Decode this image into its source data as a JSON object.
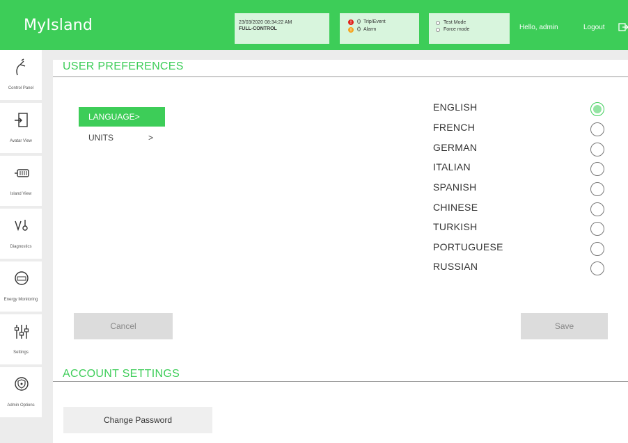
{
  "header": {
    "brand": "MyIsland",
    "datetime": "23/03/2020 08:34:22 AM",
    "control_mode": "FULL-CONTROL",
    "trips_count": "0",
    "trips_label": "Trip/Event",
    "alarms_count": "0",
    "alarms_label": "Alarm",
    "test_mode": "Test Mode",
    "force_mode": "Force mode",
    "greeting": "Hello, admin",
    "logout": "Logout",
    "exit_icon": "logout-icon",
    "accent": "#3dcd58"
  },
  "sidebar": {
    "items": [
      {
        "label": "Control Panel",
        "icon": "control-panel-icon"
      },
      {
        "label": "Avatar View",
        "icon": "avatar-view-icon"
      },
      {
        "label": "Island View",
        "icon": "island-view-icon"
      },
      {
        "label": "Diagnostics",
        "icon": "diagnostics-icon"
      },
      {
        "label": "Energy Monitoring",
        "icon": "energy-monitoring-icon"
      },
      {
        "label": "Settings",
        "icon": "settings-icon"
      },
      {
        "label": "Admin Options",
        "icon": "admin-options-icon"
      }
    ]
  },
  "preferences": {
    "title": "USER PREFERENCES",
    "categories": [
      {
        "label": "LANGUAGE",
        "chevron": ">",
        "active": true
      },
      {
        "label": "UNITS",
        "chevron": ">",
        "active": false
      }
    ],
    "languages": [
      {
        "name": "ENGLISH",
        "selected": true
      },
      {
        "name": "FRENCH",
        "selected": false
      },
      {
        "name": "GERMAN",
        "selected": false
      },
      {
        "name": "ITALIAN",
        "selected": false
      },
      {
        "name": "SPANISH",
        "selected": false
      },
      {
        "name": "CHINESE",
        "selected": false
      },
      {
        "name": "TURKISH",
        "selected": false
      },
      {
        "name": "PORTUGUESE",
        "selected": false
      },
      {
        "name": "RUSSIAN",
        "selected": false
      }
    ],
    "cancel": "Cancel",
    "save": "Save"
  },
  "account": {
    "title": "ACCOUNT SETTINGS",
    "change_password": "Change Password"
  }
}
